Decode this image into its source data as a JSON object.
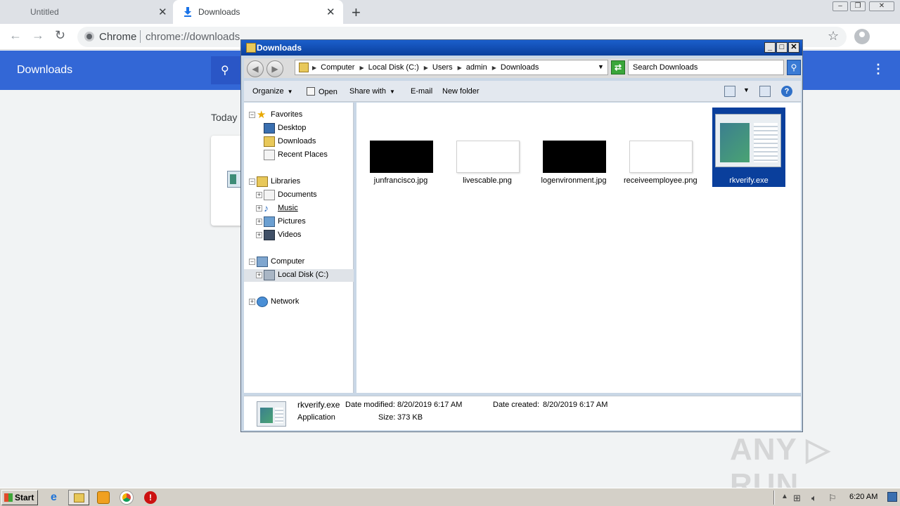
{
  "browser": {
    "tabs": [
      {
        "label": "Untitled",
        "active": false
      },
      {
        "label": "Downloads",
        "active": true
      }
    ],
    "omnibox": {
      "scheme_label": "Chrome",
      "url": "chrome://downloads"
    },
    "downloads_page": {
      "header_title": "Downloads",
      "section_label": "Today"
    }
  },
  "explorer": {
    "title": "Downloads",
    "breadcrumb": [
      "Computer",
      "Local Disk (C:)",
      "Users",
      "admin",
      "Downloads"
    ],
    "search_placeholder": "Search Downloads",
    "commands": {
      "organize": "Organize",
      "open": "Open",
      "share_with": "Share with",
      "email": "E-mail",
      "new_folder": "New folder"
    },
    "nav": {
      "favorites": "Favorites",
      "desktop": "Desktop",
      "downloads": "Downloads",
      "recent_places": "Recent Places",
      "libraries": "Libraries",
      "documents": "Documents",
      "music": "Music",
      "pictures": "Pictures",
      "videos": "Videos",
      "computer": "Computer",
      "local_disk": "Local Disk (C:)",
      "network": "Network"
    },
    "files": [
      {
        "name": "junfrancisco.jpg",
        "thumb": "black"
      },
      {
        "name": "livescable.png",
        "thumb": "white"
      },
      {
        "name": "logenvironment.jpg",
        "thumb": "black"
      },
      {
        "name": "receiveemployee.png",
        "thumb": "white"
      },
      {
        "name": "rkverify.exe",
        "thumb": "app",
        "selected": true
      }
    ],
    "details": {
      "filename": "rkverify.exe",
      "type": "Application",
      "date_modified_label": "Date modified:",
      "date_modified": "8/20/2019 6:17 AM",
      "size_label": "Size:",
      "size": "373 KB",
      "date_created_label": "Date created:",
      "date_created": "8/20/2019 6:17 AM"
    }
  },
  "taskbar": {
    "start_label": "Start",
    "clock": "6:20 AM"
  },
  "watermark": "ANY RUN"
}
